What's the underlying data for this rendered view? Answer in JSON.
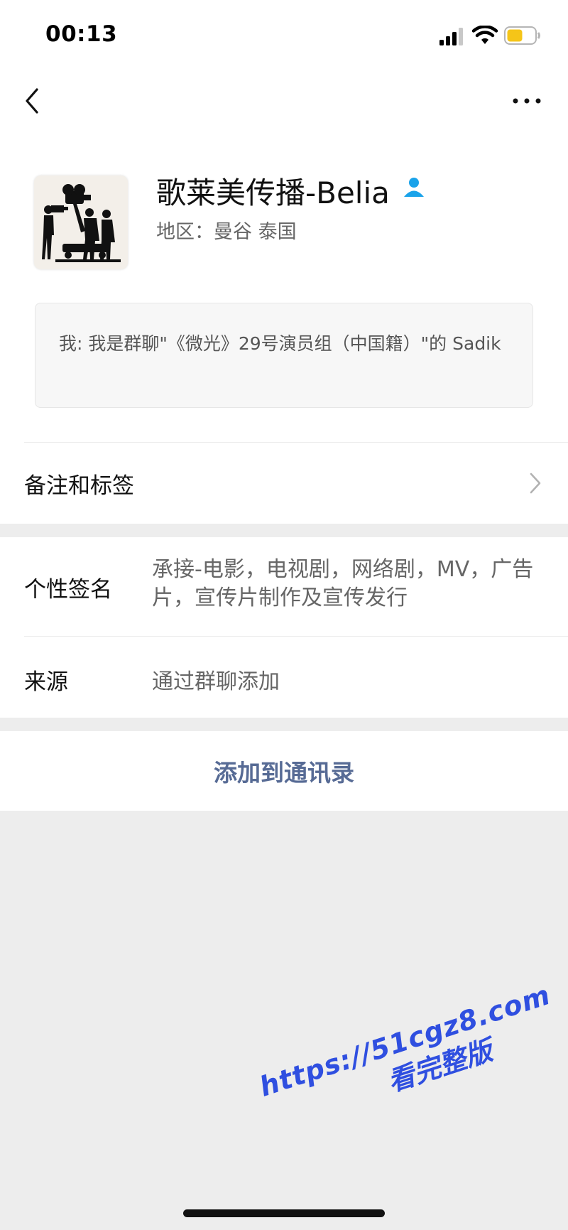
{
  "status_bar": {
    "time": "00:13",
    "signal_icon": "cellular-signal-icon",
    "wifi_icon": "wifi-icon",
    "battery_icon": "battery-icon",
    "battery_color": "#f5c518"
  },
  "nav": {
    "back_icon": "chevron-left-icon",
    "more_icon": "ellipsis-icon"
  },
  "profile": {
    "name": "歌莱美传播-Belia",
    "verified_icon": "person-badge-icon",
    "verified_color": "#1aa3ea",
    "region": "地区：曼谷 泰国",
    "message": "我: 我是群聊\"《微光》29号演员组（中国籍）\"的 Sadik"
  },
  "remarks": {
    "label": "备注和标签"
  },
  "info": {
    "signature_label": "个性签名",
    "signature_value": "承接-电影，电视剧，网络剧，MV，广告片，宣传片制作及宣传发行",
    "source_label": "来源",
    "source_value": "通过群聊添加"
  },
  "action": {
    "add_contact_label": "添加到通讯录",
    "link_color": "#576b95"
  },
  "watermark": {
    "url": "https://51cgz8.com",
    "text": "看完整版"
  }
}
